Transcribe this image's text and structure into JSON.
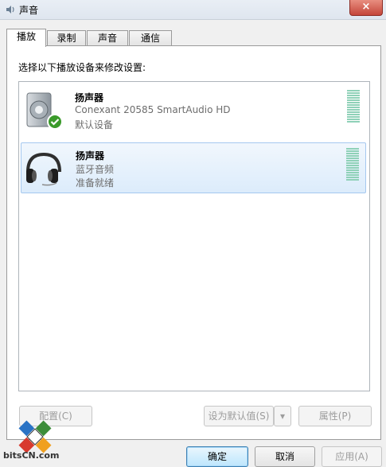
{
  "window": {
    "title": "声音",
    "close_glyph": "×"
  },
  "tabs": [
    {
      "label": "播放",
      "active": true
    },
    {
      "label": "录制",
      "active": false
    },
    {
      "label": "声音",
      "active": false
    },
    {
      "label": "通信",
      "active": false
    }
  ],
  "instruction": "选择以下播放设备来修改设置:",
  "devices": [
    {
      "name": "扬声器",
      "description": "Conexant 20585 SmartAudio HD",
      "status": "默认设备",
      "icon": "speaker-icon",
      "default": true
    },
    {
      "name": "扬声器",
      "description": "蓝牙音频",
      "status": "准备就绪",
      "icon": "headphones-icon",
      "selected": true
    }
  ],
  "buttons": {
    "configure": "配置(C)",
    "set_default": "设为默认值(S)",
    "dropdown": "▾",
    "properties": "属性(P)",
    "ok": "确定",
    "cancel": "取消",
    "apply": "应用(A)"
  },
  "watermark": {
    "text": "bitsCN.com"
  },
  "colors": {
    "meter": "#8fd1b8",
    "selection": "#dcecfb",
    "check": "#3a9a2a"
  }
}
